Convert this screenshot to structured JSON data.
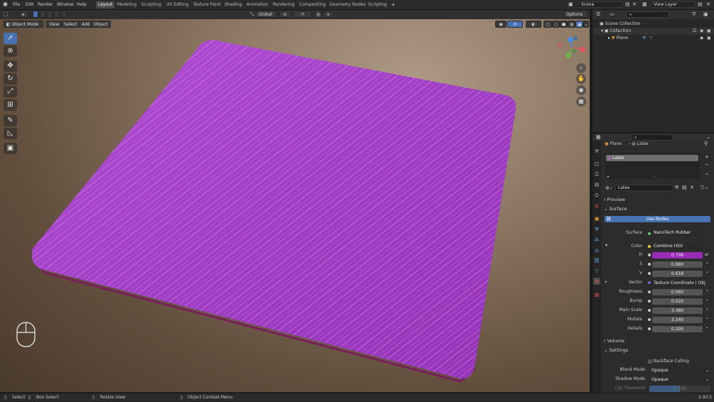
{
  "topbar": {
    "menus": [
      "File",
      "Edit",
      "Render",
      "Window",
      "Help"
    ],
    "workspaces": [
      "Layout",
      "Modeling",
      "Sculpting",
      "UV Editing",
      "Texture Paint",
      "Shading",
      "Animation",
      "Rendering",
      "Compositing",
      "Geometry Nodes",
      "Scripting"
    ],
    "active_workspace": "Layout",
    "add_tab": "+",
    "scene": "Scene",
    "view_layer": "View Layer"
  },
  "viewport": {
    "transform_orientation": "Global",
    "options_label": "Options",
    "mode": "Object Mode",
    "menus": [
      "View",
      "Select",
      "Add",
      "Object"
    ]
  },
  "outliner": {
    "root": "Scene Collection",
    "collection": "Collection",
    "object": "Plane"
  },
  "properties": {
    "breadcrumb_object": "Plane",
    "breadcrumb_material": "Latex",
    "slot_name": "Latex",
    "material_name": "Latex",
    "section_preview": "Preview",
    "section_surface": "Surface",
    "use_nodes": "Use Nodes",
    "surface_label": "Surface",
    "surface_value": "NanoTech Rubber",
    "color_label": "Color",
    "color_value": "Combine HSV",
    "h_label": "H",
    "h_value": "0.798",
    "s_label": "S",
    "s_value": "0.880",
    "v_label": "V",
    "v_value": "0.618",
    "vector_label": "Vector",
    "vector_value": "Texture Coordinate | Obje...",
    "roughness_label": "Roughness",
    "roughness_value": "0.060",
    "bump_label": "Bump",
    "bump_value": "0.020",
    "mainscale_label": "Main Scale",
    "mainscale_value": "3.480",
    "mutate_label": "Mutate",
    "mutate_value": "3.340",
    "details_label": "Details",
    "details_value": "0.200",
    "section_volume": "Volume",
    "section_settings": "Settings",
    "backface_culling": "Backface Culling",
    "blend_mode_label": "Blend Mode",
    "blend_mode_value": "Opaque",
    "shadow_mode_label": "Shadow Mode",
    "shadow_mode_value": "Opaque",
    "clip_threshold_label": "Clip Threshold",
    "clip_threshold_value": "0.500"
  },
  "statusbar": {
    "select": "Select",
    "box_select": "Box Select",
    "rotate_view": "Rotate View",
    "context_menu": "Object Context Menu",
    "version": "2.93.5"
  },
  "colors": {
    "accent": "#4772b3",
    "material": "#a03ec4",
    "h_field": "#9a2bb8"
  }
}
